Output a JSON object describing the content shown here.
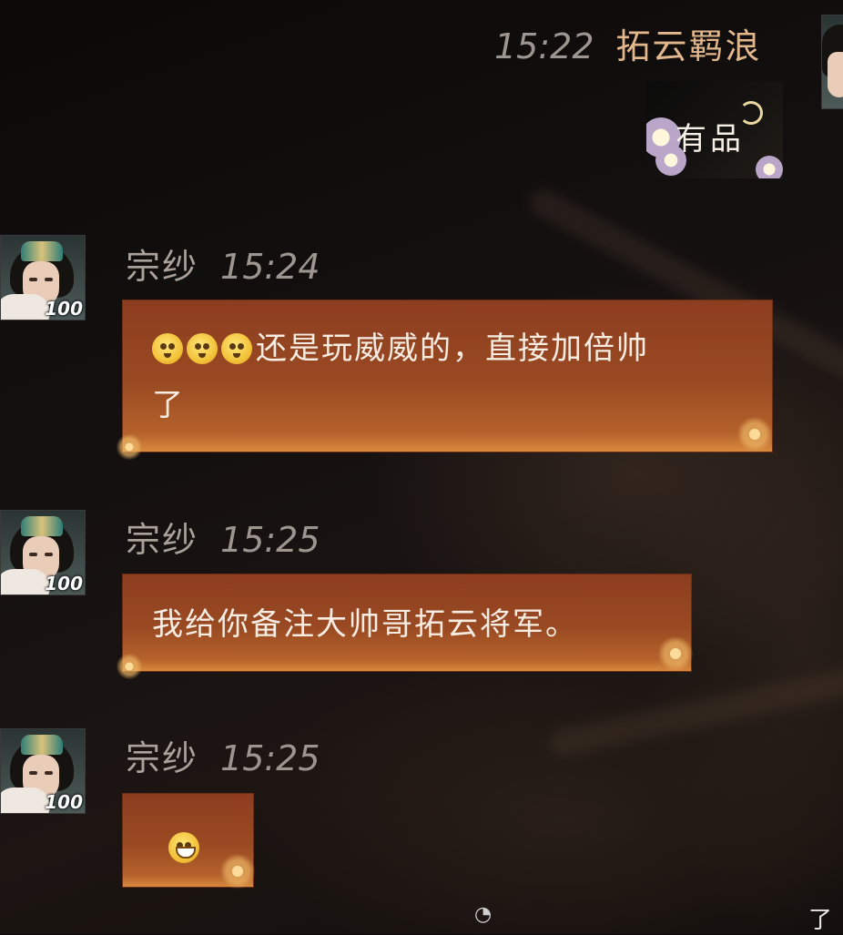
{
  "self_message": {
    "time": "15:22",
    "name": "拓云羁浪",
    "sticker_text": "有品"
  },
  "messages": [
    {
      "name": "宗纱",
      "time": "15:24",
      "level": "100",
      "emoji_prefix_count": 3,
      "line1": "还是玩威威的，直接加倍帅",
      "line2": "了"
    },
    {
      "name": "宗纱",
      "time": "15:25",
      "level": "100",
      "text": "我给你备注大帅哥拓云将军。"
    },
    {
      "name": "宗纱",
      "time": "15:25",
      "level": "100",
      "emoji": "grin-emoji"
    }
  ],
  "colors": {
    "bubble": "#9a4a22",
    "self_name": "#e2b78b",
    "background": "#0d0a09"
  },
  "watermark": {
    "icon": "weibo-icon",
    "right_text": "了"
  }
}
